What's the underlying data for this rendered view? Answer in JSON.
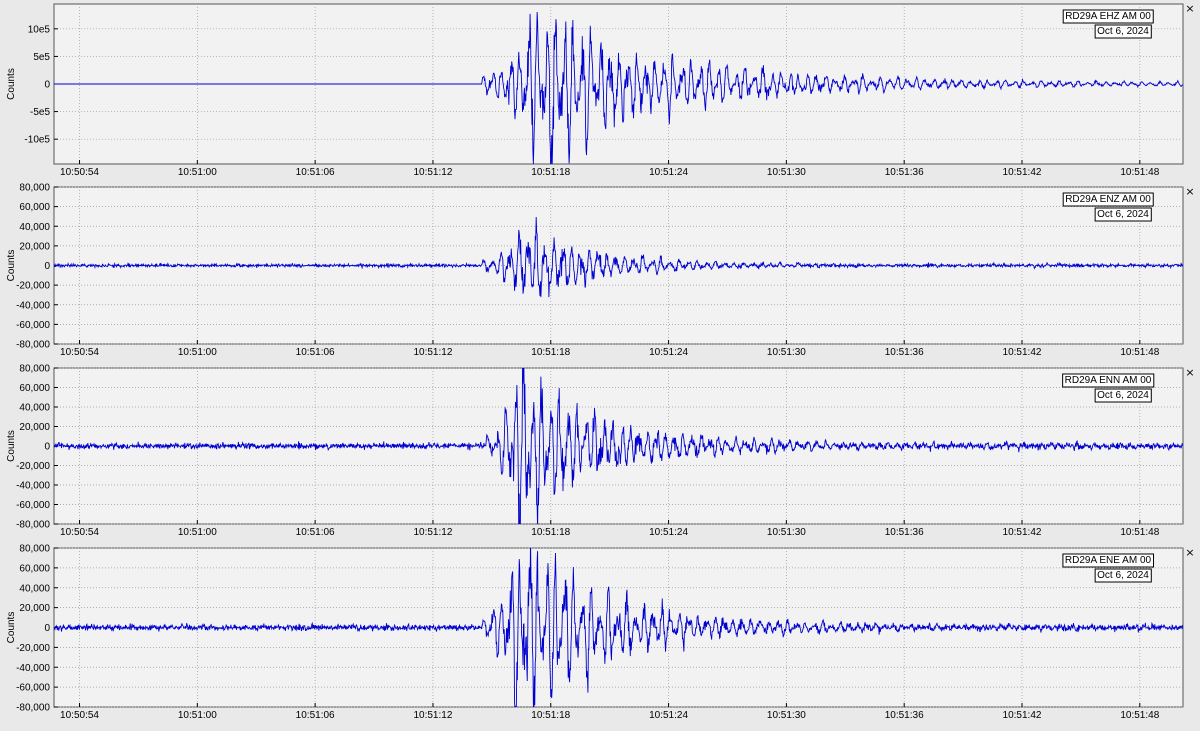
{
  "chart_data": [
    {
      "type": "line",
      "panel": "EHZ",
      "station_label": "RD29A EHZ AM 00",
      "date_label": "Oct 6, 2024",
      "ylabel": "Counts",
      "xlabel": "",
      "yticks": [
        "10e5",
        "5e5",
        "0",
        "-5e5",
        "-10e5"
      ],
      "ytick_values": [
        1000000,
        500000,
        0,
        -500000,
        -1000000
      ],
      "ylim": [
        -1450000,
        1450000
      ],
      "grid": true,
      "line_color": "#0000d0",
      "onset_s": 20.5,
      "peak_s": 23.3,
      "peak_value": 1400000,
      "noise_level": 0,
      "decay_s": 6.5,
      "tail_level": 30000,
      "flat_before_onset": true
    },
    {
      "type": "line",
      "panel": "ENZ",
      "station_label": "RD29A ENZ AM 00",
      "date_label": "Oct 6, 2024",
      "ylabel": "Counts",
      "xlabel": "",
      "yticks": [
        "80,000",
        "60,000",
        "40,000",
        "20,000",
        "0",
        "-20,000",
        "-40,000",
        "-60,000",
        "-80,000"
      ],
      "ytick_values": [
        80000,
        60000,
        40000,
        20000,
        0,
        -20000,
        -40000,
        -60000,
        -80000
      ],
      "ylim": [
        -80000,
        80000
      ],
      "grid": true,
      "line_color": "#0000d0",
      "onset_s": 20.5,
      "peak_s": 22.7,
      "peak_value": 46000,
      "noise_level": 800,
      "decay_s": 3.5,
      "tail_level": 600,
      "flat_before_onset": false
    },
    {
      "type": "line",
      "panel": "ENN",
      "station_label": "RD29A ENN AM 00",
      "date_label": "Oct 6, 2024",
      "ylabel": "Counts",
      "xlabel": "",
      "yticks": [
        "80,000",
        "60,000",
        "40,000",
        "20,000",
        "0",
        "-20,000",
        "-40,000",
        "-60,000",
        "-80,000"
      ],
      "ytick_values": [
        80000,
        60000,
        40000,
        20000,
        0,
        -20000,
        -40000,
        -60000,
        -80000
      ],
      "ylim": [
        -80000,
        80000
      ],
      "grid": true,
      "line_color": "#0000d0",
      "onset_s": 20.7,
      "peak_s": 22.3,
      "peak_value": 78000,
      "noise_level": 1500,
      "decay_s": 4.5,
      "tail_level": 1400,
      "flat_before_onset": false
    },
    {
      "type": "line",
      "panel": "ENE",
      "station_label": "RD29A ENE AM 00",
      "date_label": "Oct 6, 2024",
      "ylabel": "Counts",
      "xlabel": "",
      "yticks": [
        "80,000",
        "60,000",
        "40,000",
        "20,000",
        "0",
        "-20,000",
        "-40,000",
        "-60,000",
        "-80,000"
      ],
      "ytick_values": [
        80000,
        60000,
        40000,
        20000,
        0,
        -20000,
        -40000,
        -60000,
        -80000
      ],
      "ylim": [
        -80000,
        80000
      ],
      "grid": true,
      "line_color": "#0000d0",
      "onset_s": 20.5,
      "peak_s": 22.3,
      "peak_value": 92000,
      "noise_level": 1500,
      "decay_s": 4.5,
      "tail_level": 1400,
      "flat_before_onset": false
    }
  ],
  "x_axis": {
    "range_s": [
      -1.3,
      56.2
    ],
    "tick_offsets_s": [
      0,
      6,
      12,
      18,
      24,
      30,
      36,
      42,
      48,
      54
    ],
    "tick_labels": [
      "10:50:54",
      "10:51:00",
      "10:51:06",
      "10:51:12",
      "10:51:18",
      "10:51:24",
      "10:51:30",
      "10:51:36",
      "10:51:42",
      "10:51:48"
    ]
  },
  "controls": {
    "close_glyph": "×"
  },
  "colors": {
    "trace": "#0000d0",
    "background": "#f2f2f2",
    "grid": "#9a9a9a"
  }
}
